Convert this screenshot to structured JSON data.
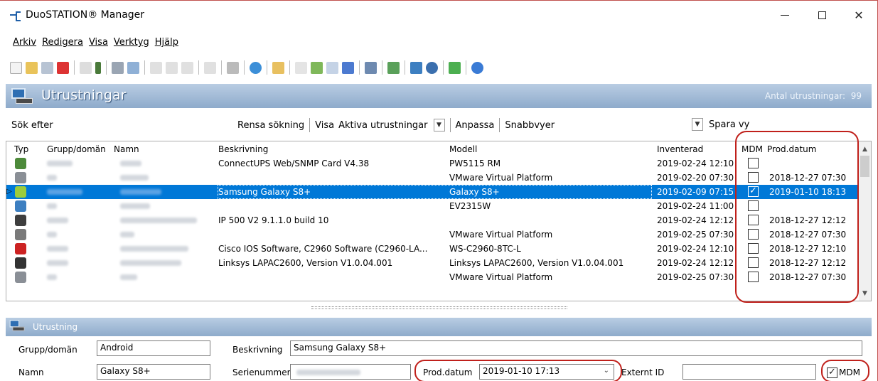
{
  "window": {
    "title": "DuoSTATION® Manager",
    "min": "—",
    "max": "☐",
    "close": "✕"
  },
  "menu": [
    "Arkiv",
    "Redigera",
    "Visa",
    "Verktyg",
    "Hjälp"
  ],
  "section": {
    "title": "Utrustningar",
    "count_label": "Antal utrustningar:",
    "count": "99"
  },
  "search": {
    "label": "Sök efter",
    "clear": "Rensa sökning",
    "show_label": "Visa",
    "show_value": "Aktiva utrustningar",
    "customize": "Anpassa",
    "quick_views": "Snabbvyer",
    "save_view": "Spara vy"
  },
  "table": {
    "headers": {
      "type": "Typ",
      "group": "Grupp/domän",
      "name": "Namn",
      "desc": "Beskrivning",
      "model": "Modell",
      "inventoried": "Inventerad",
      "mdm": "MDM",
      "prod": "Prod.datum"
    },
    "rows": [
      {
        "desc": "ConnectUPS Web/SNMP Card V4.38",
        "model": "PW5115 RM",
        "inv": "2019-02-24 12:10",
        "mdm": false,
        "prod": "",
        "icon": "ups-icon"
      },
      {
        "desc": "",
        "model": "VMware Virtual Platform",
        "inv": "2019-02-20 07:30",
        "mdm": false,
        "prod": "2018-12-27 07:30",
        "icon": "server-icon"
      },
      {
        "desc": "Samsung Galaxy S8+",
        "model": "Galaxy S8+",
        "inv": "2019-02-09 07:15",
        "mdm": true,
        "prod": "2019-01-10 18:13",
        "icon": "android-icon"
      },
      {
        "desc": "",
        "model": "EV2315W",
        "inv": "2019-02-24 11:00",
        "mdm": false,
        "prod": "",
        "icon": "monitor-icon"
      },
      {
        "desc": "IP 500 V2 9.1.1.0 build 10",
        "model": "",
        "inv": "2019-02-24 12:12",
        "mdm": false,
        "prod": "2018-12-27 12:12",
        "icon": "phone-system-icon"
      },
      {
        "desc": "",
        "model": "VMware Virtual Platform",
        "inv": "2019-02-25 07:30",
        "mdm": false,
        "prod": "2018-12-27 07:30",
        "icon": "server-group-icon"
      },
      {
        "desc": "Cisco IOS Software, C2960 Software (C2960-LA...",
        "model": "WS-C2960-8TC-L",
        "inv": "2019-02-24 12:10",
        "mdm": false,
        "prod": "2018-12-27 12:10",
        "icon": "switch-icon"
      },
      {
        "desc": "Linksys LAPAC2600, Version V1.0.04.001",
        "model": "Linksys LAPAC2600, Version V1.0.04.001",
        "inv": "2019-02-24 12:12",
        "mdm": false,
        "prod": "2018-12-27 12:12",
        "icon": "access-point-icon"
      },
      {
        "desc": "",
        "model": "VMware Virtual Platform",
        "inv": "2019-02-25 07:30",
        "mdm": false,
        "prod": "2018-12-27 07:30",
        "icon": "server-icon"
      }
    ]
  },
  "detail": {
    "title": "Utrustning",
    "group_label": "Grupp/domän",
    "group_value": "Android",
    "name_label": "Namn",
    "name_value": "Galaxy S8+",
    "desc_label": "Beskrivning",
    "desc_value": "Samsung Galaxy S8+",
    "serial_label": "Serienummer",
    "prod_label": "Prod.datum",
    "prod_value": "2019-01-10 17:13",
    "ext_label": "Externt ID",
    "ext_value": "",
    "mdm_label": "MDM",
    "mdm": true
  },
  "colors": {
    "selection": "#0078d7",
    "header": "#8eabcb",
    "highlight": "#c0201b"
  }
}
